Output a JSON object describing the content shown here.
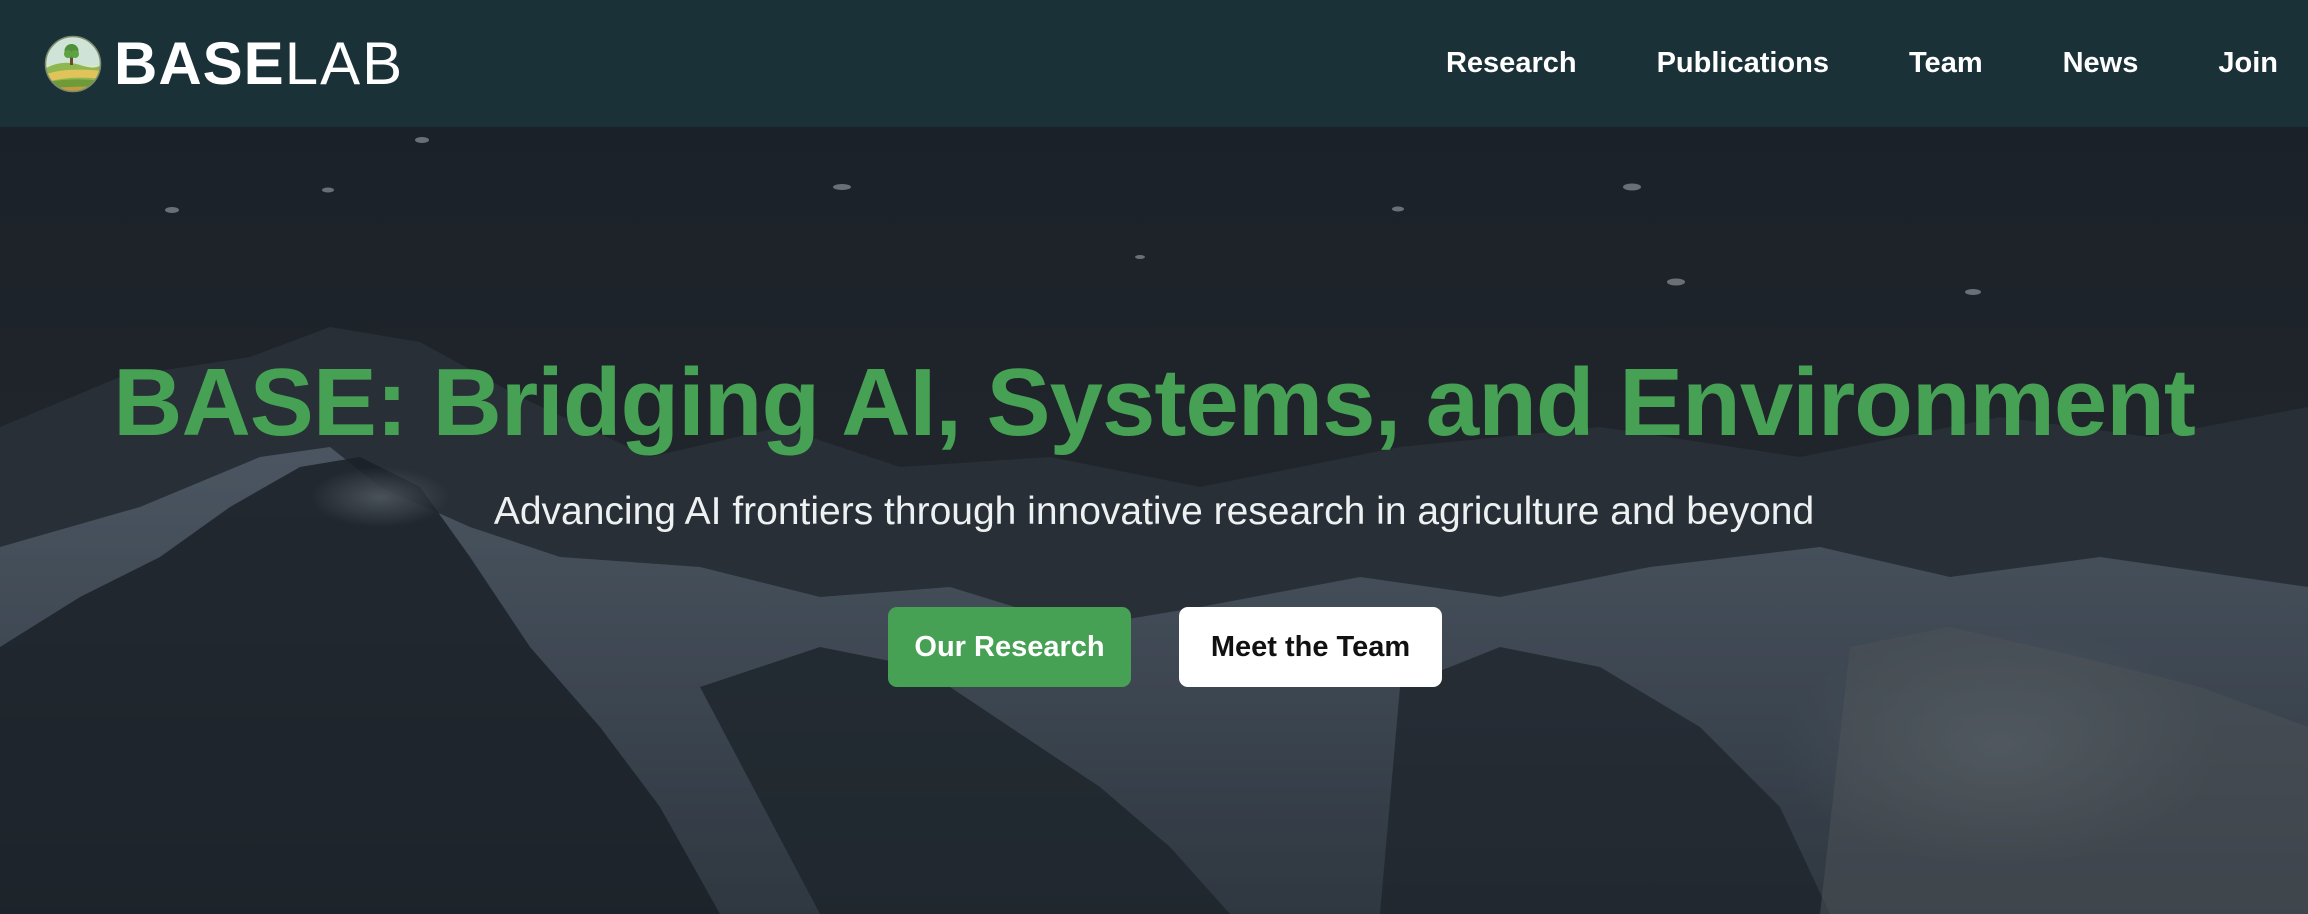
{
  "header": {
    "brand": {
      "bold": "BASE",
      "light": "LAB",
      "logo_icon": "farm-landscape-icon"
    },
    "nav": [
      {
        "label": "Research"
      },
      {
        "label": "Publications"
      },
      {
        "label": "Team"
      },
      {
        "label": "News"
      },
      {
        "label": "Join"
      }
    ],
    "background_color": "#1b3138"
  },
  "hero": {
    "title": "BASE: Bridging AI, Systems, and Environment",
    "subtitle": "Advancing AI frontiers through innovative research in agriculture and beyond",
    "primary_button": {
      "label": "Our Research"
    },
    "secondary_button": {
      "label": "Meet the Team"
    },
    "background": "snowy-mountain-night-image",
    "accent_color": "#47a154"
  }
}
